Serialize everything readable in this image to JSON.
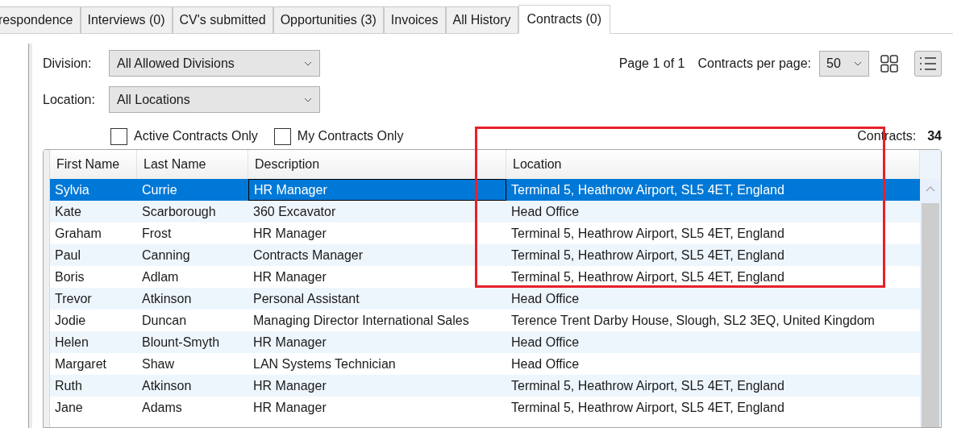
{
  "tabs": [
    {
      "label": "respondence",
      "selected": false
    },
    {
      "label": "Interviews (0)",
      "selected": false
    },
    {
      "label": "CV's submitted",
      "selected": false
    },
    {
      "label": "Opportunities (3)",
      "selected": false
    },
    {
      "label": "Invoices",
      "selected": false
    },
    {
      "label": "All History",
      "selected": false
    },
    {
      "label": "Contracts (0)",
      "selected": true
    }
  ],
  "filters": [
    {
      "label": "Division:",
      "value": "All Allowed Divisions"
    },
    {
      "label": "Location:",
      "value": "All Locations"
    }
  ],
  "checkboxes": [
    {
      "label": "Active Contracts Only",
      "checked": false
    },
    {
      "label": "My Contracts Only",
      "checked": false
    }
  ],
  "paging": {
    "page": "Page 1 of 1",
    "per_page_label": "Contracts per page:",
    "per_page": "50"
  },
  "count": {
    "label": "Contracts:",
    "value": "34"
  },
  "table": {
    "columns": [
      "First Name",
      "Last Name",
      "Description",
      "Location"
    ],
    "rows": [
      {
        "cells": [
          "Sylvia",
          "Currie",
          "HR Manager",
          "Terminal 5, Heathrow Airport, SL5 4ET, England"
        ],
        "selected": true
      },
      {
        "cells": [
          "Kate",
          "Scarborough",
          "360 Excavator",
          "Head Office"
        ],
        "selected": false
      },
      {
        "cells": [
          "Graham",
          "Frost",
          "HR Manager",
          "Terminal 5, Heathrow Airport, SL5 4ET, England"
        ],
        "selected": false
      },
      {
        "cells": [
          "Paul",
          "Canning",
          "Contracts Manager",
          "Terminal 5, Heathrow Airport, SL5 4ET, England"
        ],
        "selected": false
      },
      {
        "cells": [
          "Boris",
          "Adlam",
          "HR Manager",
          "Terminal 5, Heathrow Airport, SL5 4ET, England"
        ],
        "selected": false
      },
      {
        "cells": [
          "Trevor",
          "Atkinson",
          "Personal Assistant",
          "Head Office"
        ],
        "selected": false
      },
      {
        "cells": [
          "Jodie",
          "Duncan",
          "Managing Director International Sales",
          "Terence Trent Darby House, Slough, SL2 3EQ, United Kingdom"
        ],
        "selected": false
      },
      {
        "cells": [
          "Helen",
          "Blount-Smyth",
          "HR Manager",
          "Head Office"
        ],
        "selected": false
      },
      {
        "cells": [
          "Margaret",
          "Shaw",
          "LAN Systems Technician",
          "Head Office"
        ],
        "selected": false
      },
      {
        "cells": [
          "Ruth",
          "Atkinson",
          "HR Manager",
          "Terminal 5, Heathrow Airport, SL5 4ET, England"
        ],
        "selected": false
      },
      {
        "cells": [
          "Jane",
          "Adams",
          "HR Manager",
          "Terminal 5, Heathrow Airport, SL5 4ET, England"
        ],
        "selected": false
      }
    ]
  }
}
